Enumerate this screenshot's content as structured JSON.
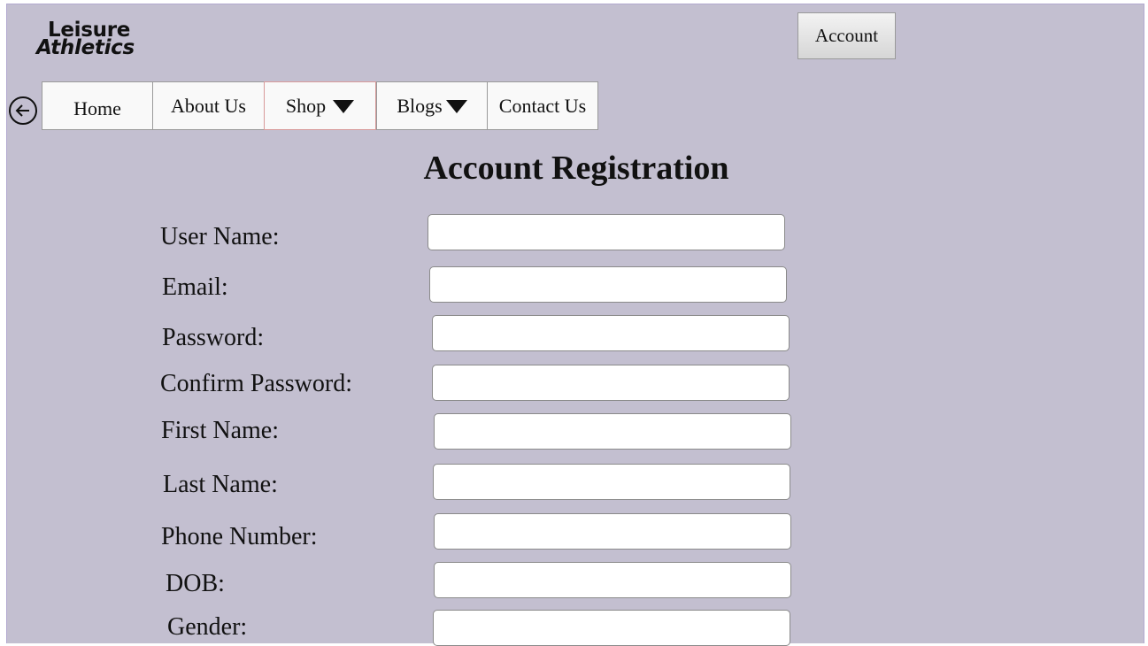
{
  "brand": {
    "line1": "Leisure",
    "line2": "Athletics"
  },
  "header": {
    "account_label": "Account"
  },
  "nav": {
    "back_icon": "arrow-left-circle-icon",
    "items": [
      {
        "label": "Home",
        "has_dropdown": false
      },
      {
        "label": "About Us",
        "has_dropdown": false
      },
      {
        "label": "Shop",
        "has_dropdown": true
      },
      {
        "label": "Blogs",
        "has_dropdown": true
      },
      {
        "label": "Contact Us",
        "has_dropdown": false
      }
    ],
    "active": "Shop"
  },
  "page": {
    "title": "Account Registration"
  },
  "form": {
    "fields": [
      {
        "label": "User Name:",
        "value": "",
        "placeholder": ""
      },
      {
        "label": "Email:",
        "value": "",
        "placeholder": ""
      },
      {
        "label": "Password:",
        "value": "",
        "placeholder": ""
      },
      {
        "label": "Confirm Password:",
        "value": "",
        "placeholder": ""
      },
      {
        "label": "First Name:",
        "value": "",
        "placeholder": ""
      },
      {
        "label": "Last Name:",
        "value": "",
        "placeholder": ""
      },
      {
        "label": "Phone Number:",
        "value": "",
        "placeholder": ""
      },
      {
        "label": "DOB:",
        "value": "",
        "placeholder": ""
      },
      {
        "label": "Gender:",
        "value": "",
        "placeholder": ""
      }
    ]
  },
  "colors": {
    "background": "#c3bfd0",
    "nav_bg": "#f9f9f9",
    "active_border": "#d89a9a"
  }
}
